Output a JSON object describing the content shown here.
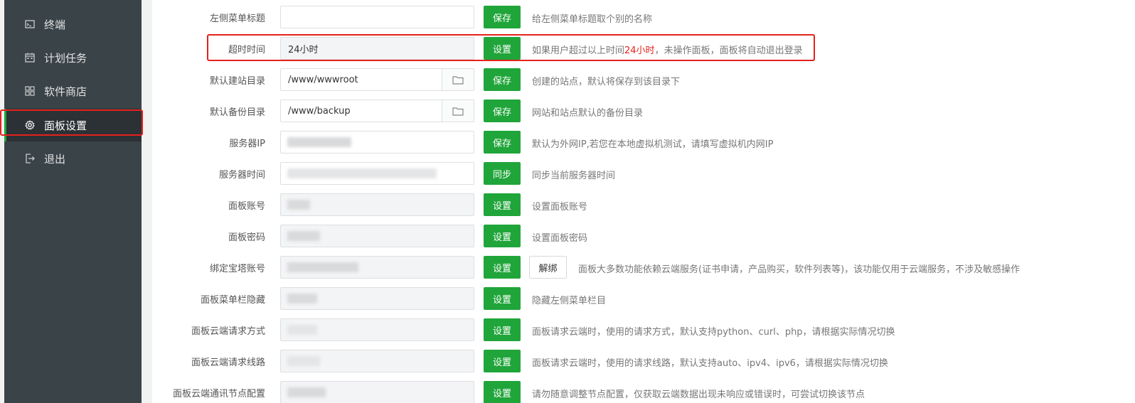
{
  "sidebar": {
    "items": [
      {
        "label": "终端",
        "icon": "terminal-icon"
      },
      {
        "label": "计划任务",
        "icon": "calendar-icon"
      },
      {
        "label": "软件商店",
        "icon": "grid-icon"
      },
      {
        "label": "面板设置",
        "icon": "gear-icon",
        "active": true
      },
      {
        "label": "退出",
        "icon": "logout-icon"
      }
    ]
  },
  "settings": {
    "menu_title": {
      "label": "左侧菜单标题",
      "value": "",
      "button": "保存",
      "tip": "给左侧菜单标题取个别的名称"
    },
    "timeout": {
      "label": "超时时间",
      "value": "24小时",
      "button": "设置",
      "tip_prefix": "如果用户超过以上时间",
      "tip_highlight": "24小时",
      "tip_suffix": "，未操作面板，面板将自动退出登录"
    },
    "site_dir": {
      "label": "默认建站目录",
      "value": "/www/wwwroot",
      "button": "保存",
      "tip": "创建的站点，默认将保存到该目录下"
    },
    "backup_dir": {
      "label": "默认备份目录",
      "value": "/www/backup",
      "button": "保存",
      "tip": "网站和站点默认的备份目录"
    },
    "server_ip": {
      "label": "服务器IP",
      "button": "保存",
      "tip": "默认为外网IP,若您在本地虚拟机测试，请填写虚拟机内网IP"
    },
    "server_time": {
      "label": "服务器时间",
      "button": "同步",
      "tip": "同步当前服务器时间"
    },
    "panel_account": {
      "label": "面板账号",
      "button": "设置",
      "tip": "设置面板账号"
    },
    "panel_password": {
      "label": "面板密码",
      "button": "设置",
      "tip": "设置面板密码"
    },
    "bt_account": {
      "label": "绑定宝塔账号",
      "button": "设置",
      "button2": "解绑",
      "tip": "面板大多数功能依赖云端服务(证书申请，产品购买，软件列表等)，该功能仅用于云端服务，不涉及敏感操作"
    },
    "menu_hide": {
      "label": "面板菜单栏隐藏",
      "button": "设置",
      "tip": "隐藏左侧菜单栏目"
    },
    "cloud_method": {
      "label": "面板云端请求方式",
      "button": "设置",
      "tip": "面板请求云端时，使用的请求方式，默认支持python、curl、php，请根据实际情况切换"
    },
    "cloud_line": {
      "label": "面板云端请求线路",
      "button": "设置",
      "tip": "面板请求云端时，使用的请求线路，默认支持auto、ipv4、ipv6，请根据实际情况切换"
    },
    "cloud_node": {
      "label": "面板云端通讯节点配置",
      "button": "设置",
      "tip": "请勿随意调整节点配置，仅获取云端数据出现未响应或错误时，可尝试切换该节点"
    }
  },
  "colors": {
    "accent": "#20a53a",
    "highlight": "#e5211b",
    "sidebar_bg": "#3a4348"
  }
}
